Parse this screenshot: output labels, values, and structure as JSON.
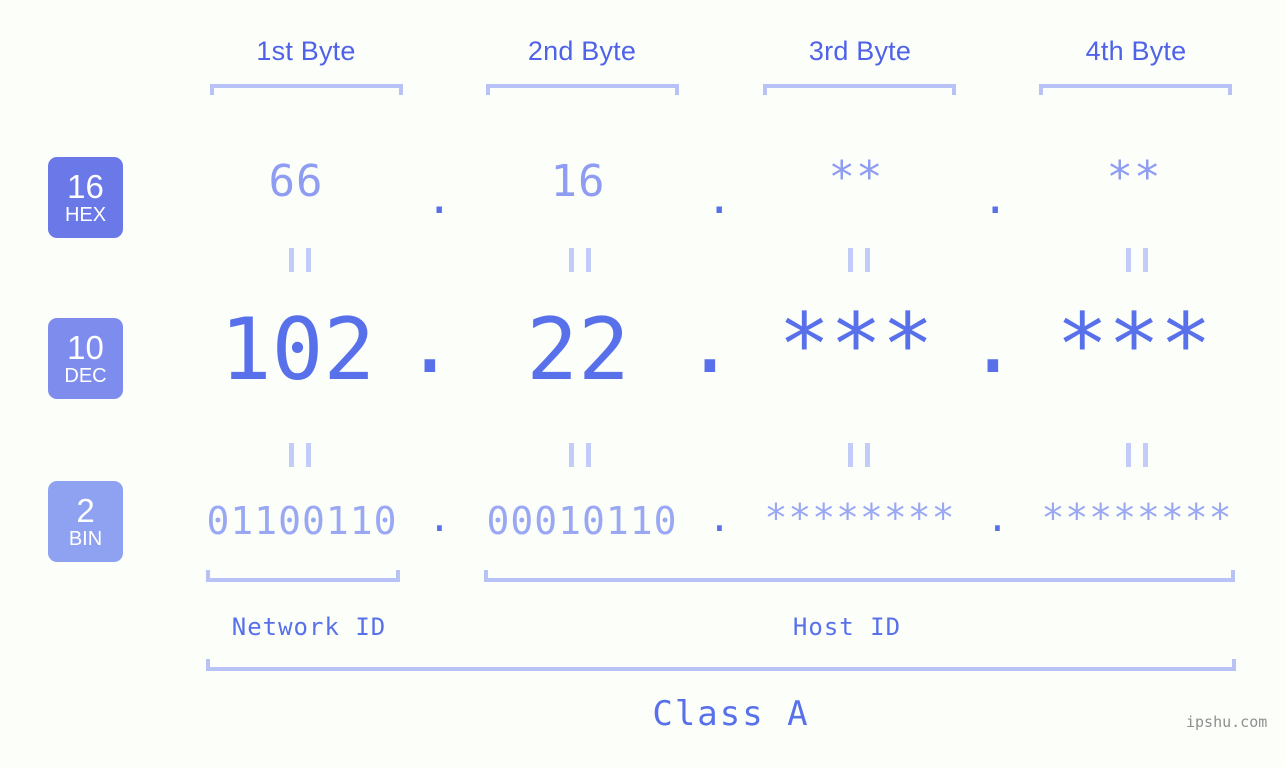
{
  "background_color": "#fcfefa",
  "accent_color": "#5871ea",
  "bracket_color": "#b8c2f7",
  "header": {
    "byte_labels": [
      "1st Byte",
      "2nd Byte",
      "3rd Byte",
      "4th Byte"
    ]
  },
  "bases": [
    {
      "number": "16",
      "name": "HEX",
      "color": "#6b79e8"
    },
    {
      "number": "10",
      "name": "DEC",
      "color": "#7e8cee"
    },
    {
      "number": "2",
      "name": "BIN",
      "color": "#8fa2f2"
    }
  ],
  "rows": {
    "hex": {
      "values": [
        "66",
        "16",
        "**",
        "**"
      ],
      "separator": "."
    },
    "dec": {
      "values": [
        "102",
        "22",
        "***",
        "***"
      ],
      "separator": "."
    },
    "bin": {
      "values": [
        "01100110",
        "00010110",
        "********",
        "********"
      ],
      "separator": "."
    }
  },
  "equals_symbol": "=",
  "sections": {
    "network_id": "Network ID",
    "host_id": "Host ID",
    "class": "Class A"
  },
  "watermark": "ipshu.com"
}
